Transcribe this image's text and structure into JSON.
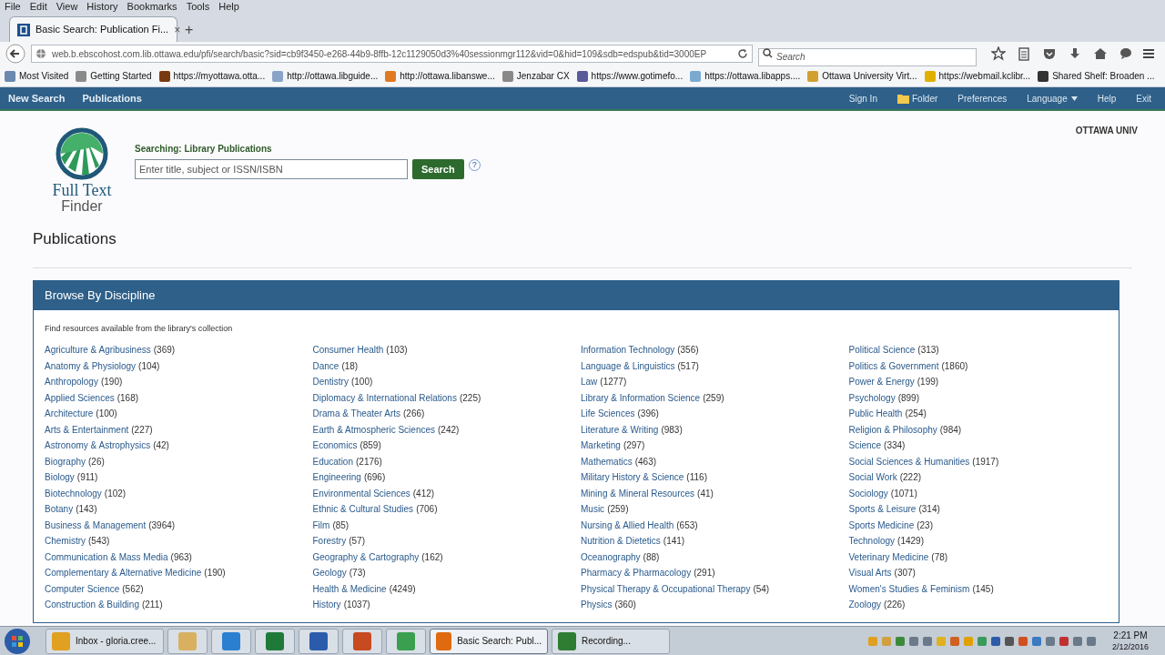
{
  "menu_bar": [
    "File",
    "Edit",
    "View",
    "History",
    "Bookmarks",
    "Tools",
    "Help"
  ],
  "tab": {
    "title": "Basic Search: Publication Fi...",
    "close": "×",
    "selected": true
  },
  "new_tab": "+",
  "address": "web.b.ebscohost.com.lib.ottawa.edu/pfi/search/basic?sid=cb9f3450-e268-44b9-8ffb-12c1129050d3%40sessionmgr112&vid=0&hid=109&sdb=edspub&tid=3000EP",
  "browser_search": {
    "placeholder": "Search"
  },
  "bookmarks": [
    "Most Visited",
    "Getting Started",
    "https://myottawa.otta...",
    "http://ottawa.libguide...",
    "http://ottawa.libanswe...",
    "Jenzabar CX",
    "https://www.gotimefo...",
    "https://ottawa.libapps....",
    "Ottawa University Virt...",
    "https://webmail.kclibr...",
    "Shared Shelf: Broaden ..."
  ],
  "site_nav": {
    "left": [
      "New Search",
      "Publications"
    ],
    "right": [
      {
        "label": "Sign In",
        "kind": "link"
      },
      {
        "label": "Folder",
        "kind": "folder"
      },
      {
        "label": "Preferences",
        "kind": "link"
      },
      {
        "label": "Language",
        "kind": "dropdown"
      },
      {
        "label": "Help",
        "kind": "link"
      },
      {
        "label": "Exit",
        "kind": "link"
      }
    ]
  },
  "logo": {
    "line1": "Full Text",
    "line2": "Finder"
  },
  "institution": "OTTAWA UNIV",
  "search": {
    "label": "Searching: Library Publications",
    "placeholder": "Enter title, subject or ISSN/ISBN",
    "button": "Search",
    "help": "?"
  },
  "page_title": "Publications",
  "panel": {
    "title": "Browse By Discipline",
    "intro": "Find resources available from the library's collection",
    "columns": [
      [
        {
          "name": "Agriculture & Agribusiness",
          "count": "(369)"
        },
        {
          "name": "Anatomy & Physiology",
          "count": "(104)"
        },
        {
          "name": "Anthropology",
          "count": "(190)"
        },
        {
          "name": "Applied Sciences",
          "count": "(168)"
        },
        {
          "name": "Architecture",
          "count": "(100)"
        },
        {
          "name": "Arts & Entertainment",
          "count": "(227)"
        },
        {
          "name": "Astronomy & Astrophysics",
          "count": "(42)"
        },
        {
          "name": "Biography",
          "count": "(26)"
        },
        {
          "name": "Biology",
          "count": "(911)"
        },
        {
          "name": "Biotechnology",
          "count": "(102)"
        },
        {
          "name": "Botany",
          "count": "(143)"
        },
        {
          "name": "Business & Management",
          "count": "(3964)"
        },
        {
          "name": "Chemistry",
          "count": "(543)"
        },
        {
          "name": "Communication & Mass Media",
          "count": "(963)"
        },
        {
          "name": "Complementary & Alternative Medicine",
          "count": "(190)"
        },
        {
          "name": "Computer Science",
          "count": "(562)"
        },
        {
          "name": "Construction & Building",
          "count": "(211)"
        }
      ],
      [
        {
          "name": "Consumer Health",
          "count": "(103)"
        },
        {
          "name": "Dance",
          "count": "(18)"
        },
        {
          "name": "Dentistry",
          "count": "(100)"
        },
        {
          "name": "Diplomacy & International Relations",
          "count": "(225)"
        },
        {
          "name": "Drama & Theater Arts",
          "count": "(266)"
        },
        {
          "name": "Earth & Atmospheric Sciences",
          "count": "(242)"
        },
        {
          "name": "Economics",
          "count": "(859)"
        },
        {
          "name": "Education",
          "count": "(2176)"
        },
        {
          "name": "Engineering",
          "count": "(696)"
        },
        {
          "name": "Environmental Sciences",
          "count": "(412)"
        },
        {
          "name": "Ethnic & Cultural Studies",
          "count": "(706)"
        },
        {
          "name": "Film",
          "count": "(85)"
        },
        {
          "name": "Forestry",
          "count": "(57)"
        },
        {
          "name": "Geography & Cartography",
          "count": "(162)"
        },
        {
          "name": "Geology",
          "count": "(73)"
        },
        {
          "name": "Health & Medicine",
          "count": "(4249)"
        },
        {
          "name": "History",
          "count": "(1037)"
        }
      ],
      [
        {
          "name": "Information Technology",
          "count": "(356)"
        },
        {
          "name": "Language & Linguistics",
          "count": "(517)"
        },
        {
          "name": "Law",
          "count": "(1277)"
        },
        {
          "name": "Library & Information Science",
          "count": "(259)"
        },
        {
          "name": "Life Sciences",
          "count": "(396)"
        },
        {
          "name": "Literature & Writing",
          "count": "(983)"
        },
        {
          "name": "Marketing",
          "count": "(297)"
        },
        {
          "name": "Mathematics",
          "count": "(463)"
        },
        {
          "name": "Military History & Science",
          "count": "(116)"
        },
        {
          "name": "Mining & Mineral Resources",
          "count": "(41)"
        },
        {
          "name": "Music",
          "count": "(259)"
        },
        {
          "name": "Nursing & Allied Health",
          "count": "(653)"
        },
        {
          "name": "Nutrition & Dietetics",
          "count": "(141)"
        },
        {
          "name": "Oceanography",
          "count": "(88)"
        },
        {
          "name": "Pharmacy & Pharmacology",
          "count": "(291)"
        },
        {
          "name": "Physical Therapy & Occupational Therapy",
          "count": "(54)"
        },
        {
          "name": "Physics",
          "count": "(360)"
        }
      ],
      [
        {
          "name": "Political Science",
          "count": "(313)"
        },
        {
          "name": "Politics & Government",
          "count": "(1860)"
        },
        {
          "name": "Power & Energy",
          "count": "(199)"
        },
        {
          "name": "Psychology",
          "count": "(899)"
        },
        {
          "name": "Public Health",
          "count": "(254)"
        },
        {
          "name": "Religion & Philosophy",
          "count": "(984)"
        },
        {
          "name": "Science",
          "count": "(334)"
        },
        {
          "name": "Social Sciences & Humanities",
          "count": "(1917)"
        },
        {
          "name": "Social Work",
          "count": "(222)"
        },
        {
          "name": "Sociology",
          "count": "(1071)"
        },
        {
          "name": "Sports & Leisure",
          "count": "(314)"
        },
        {
          "name": "Sports Medicine",
          "count": "(23)"
        },
        {
          "name": "Technology",
          "count": "(1429)"
        },
        {
          "name": "Veterinary Medicine",
          "count": "(78)"
        },
        {
          "name": "Visual Arts",
          "count": "(307)"
        },
        {
          "name": "Women's Studies & Feminism",
          "count": "(145)"
        },
        {
          "name": "Zoology",
          "count": "(226)"
        }
      ]
    ]
  },
  "taskbar": [
    {
      "label": "Inbox - gloria.cree...",
      "color": "#e0a020",
      "selected": false
    },
    {
      "color": "#d8b060",
      "selected": false
    },
    {
      "color": "#2a7fd0",
      "selected": false
    },
    {
      "color": "#1f7a3a",
      "selected": false
    },
    {
      "color": "#2a5cab",
      "selected": false
    },
    {
      "color": "#c84a20",
      "selected": false
    },
    {
      "color": "#3aa050",
      "selected": false
    },
    {
      "label": "Basic Search: Publ...",
      "color": "#e06a10",
      "selected": true
    },
    {
      "label": "Recording...",
      "color": "#2e7d32",
      "selected": false
    }
  ],
  "clock": {
    "time": "2:21 PM",
    "date": "2/12/2016"
  }
}
